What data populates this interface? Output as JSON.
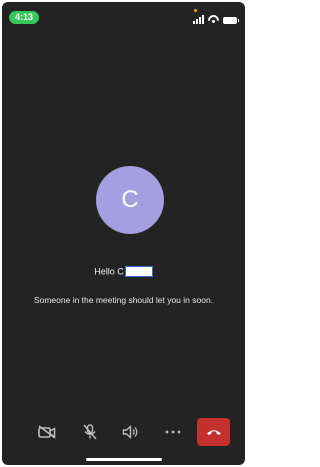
{
  "status_bar": {
    "time": "4:13",
    "time_badge_color": "#35c759",
    "icons": [
      "signal-icon",
      "wifi-icon",
      "battery-icon"
    ]
  },
  "participant": {
    "avatar_initial": "C",
    "avatar_color": "#a59ee0",
    "greeting": "Hello C"
  },
  "lobby_message": "Someone in the meeting should let you in soon.",
  "toolbar": {
    "buttons": [
      "camera-off-icon",
      "mic-off-icon",
      "speaker-icon",
      "more-options-icon",
      "end-call-icon"
    ],
    "end_call_color": "#c3312f"
  }
}
